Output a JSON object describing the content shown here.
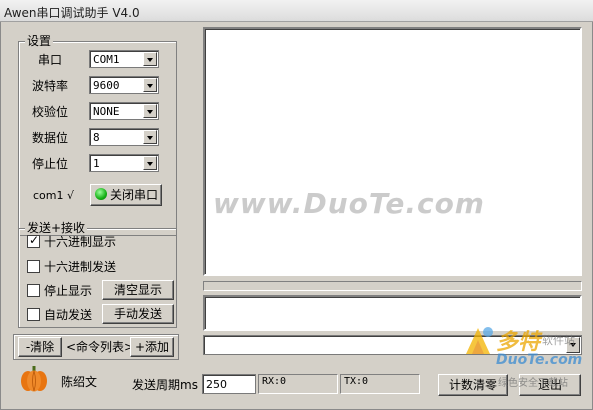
{
  "window": {
    "title": "Awen串口调试助手 V4.0"
  },
  "settings": {
    "legend": "设置",
    "port_label": "串口",
    "port_value": "COM1",
    "baud_label": "波特率",
    "baud_value": "9600",
    "parity_label": "校验位",
    "parity_value": "NONE",
    "databits_label": "数据位",
    "databits_value": "8",
    "stopbits_label": "停止位",
    "stopbits_value": "1",
    "status_text": "com1 √",
    "close_port_button": "关闭串口"
  },
  "send_recv": {
    "legend": "发送+接收",
    "hex_display": {
      "label": "十六进制显示",
      "checked": true
    },
    "hex_send": {
      "label": "十六进制发送",
      "checked": false
    },
    "stop_display": {
      "label": "停止显示",
      "checked": false
    },
    "auto_send": {
      "label": "自动发送",
      "checked": false
    },
    "clear_display_button": "清空显示",
    "manual_send_button": "手动发送"
  },
  "commands": {
    "clear_button": "-清除",
    "list_label": "<命令列表>",
    "add_button": "+添加"
  },
  "footer": {
    "author": "陈绍文",
    "period_label": "发送周期ms",
    "period_value": "250",
    "rx": "RX:0",
    "tx": "TX:0",
    "clear_count_button": "计数清零",
    "exit_button": "退出"
  },
  "watermarks": {
    "duote": "www.DuoTe.com",
    "logo_cn": "多特",
    "logo_sub": "软件站",
    "logo_en": "DuoTe.com",
    "logo_tag": "绿色安全下载站"
  },
  "colors": {
    "led": "#15b015",
    "pumpkin": "#e87511"
  }
}
